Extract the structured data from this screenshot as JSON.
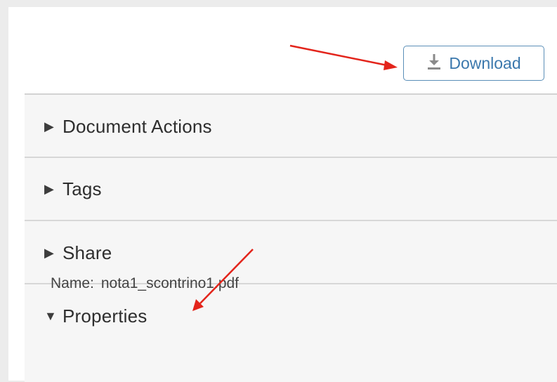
{
  "toolbar": {
    "download_label": "Download",
    "download_icon": "download-icon"
  },
  "sections": [
    {
      "label": "Document Actions",
      "expanded": false
    },
    {
      "label": "Tags",
      "expanded": false
    },
    {
      "label": "Share",
      "expanded": false
    },
    {
      "label": "Properties",
      "expanded": true
    }
  ],
  "properties": {
    "name_key": "Name:",
    "name_value": "nota1_scontrino1.pdf"
  },
  "colors": {
    "accent": "#3b78ad",
    "annotation_arrow": "#e3241b"
  }
}
